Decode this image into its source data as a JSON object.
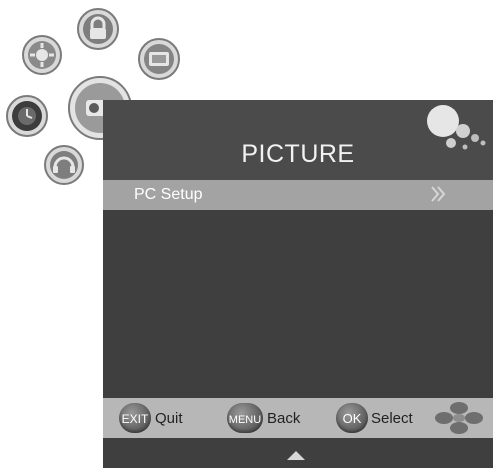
{
  "menu": {
    "title": "PICTURE",
    "items": [
      {
        "label": "PC Setup",
        "selected": true
      }
    ]
  },
  "footer": {
    "exit_key": "EXIT",
    "exit_label": "Quit",
    "menu_key": "MENU",
    "menu_label": "Back",
    "ok_key": "OK",
    "ok_label": "Select"
  },
  "side_icons": [
    "settings-icon",
    "lock-icon",
    "tv-icon",
    "clock-icon",
    "camera-icon",
    "headset-icon"
  ],
  "colors": {
    "panel": "#4b4b4b",
    "selected_row": "#a3a3a3",
    "footer": "#b7b7b7"
  }
}
